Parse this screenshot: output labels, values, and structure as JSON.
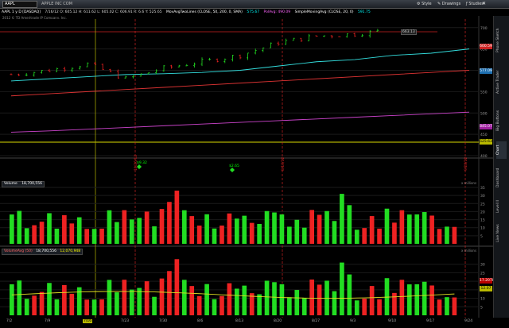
{
  "toolbar": {
    "symbol": "AAPL",
    "company": "APPLE INC COM",
    "buttons": [
      {
        "label": "Style"
      },
      {
        "label": "Drawings"
      },
      {
        "label": "Studies"
      }
    ]
  },
  "studybar": {
    "chart_id": "AAPL 1 y D [DASDAQ]",
    "ohlc": "7/16/12 O: 605.12 H: 611.62 L: 605.02 C: 606.91 R: 6.6 Y: 525.65",
    "studies": [
      {
        "text": "MovAvgTwoLines (CLOSE, 50, 200, 0, SMA)",
        "color": "#ffffff"
      },
      {
        "text": "575.67",
        "color": "#00ffff"
      },
      {
        "text": "PolAvg: 490.09",
        "color": "#ff66ff"
      },
      {
        "text": "SimpleMovingAvg (CLOSE, 20, 0)",
        "color": "#ffffff"
      },
      {
        "text": "591.75",
        "color": "#00ffff"
      }
    ],
    "copyright": "2012 © TD Ameritrade IP Company, Inc."
  },
  "price_panel": {
    "y_ticks": [
      "700",
      "650",
      "600",
      "550",
      "500",
      "450",
      "400",
      "350"
    ],
    "price_boxes": [
      {
        "label": "600.59",
        "color": "#cc2222"
      },
      {
        "label": "577.09",
        "color": "#1e6fb0"
      },
      {
        "label": "845.07",
        "color": "#a020a0"
      },
      {
        "label": "525.63",
        "color": "#b8b800"
      }
    ],
    "high_label": "663.13",
    "events": [
      {
        "label": "$9.32"
      },
      {
        "label": "$2.65"
      }
    ],
    "vertical_labels": [
      "10/26/12",
      "8/10/12",
      "9/28/12"
    ]
  },
  "volume_panel": {
    "title": "Volume",
    "value": "18,700,556",
    "y_ticks": [
      "35",
      "30",
      "25",
      "20",
      "15",
      "10",
      "5"
    ],
    "units": "x millions"
  },
  "volavg_panel": {
    "title": "VolumeAvg (50)",
    "value1": "18,700,556",
    "value2": "12,070,948",
    "y_ticks": [
      "30",
      "25",
      "20",
      "15",
      "10",
      "5"
    ],
    "boxes": [
      {
        "label": "17.2078",
        "color": "#b80000"
      },
      {
        "label": "12.07",
        "color": "#b8b800"
      }
    ],
    "units": "x millions"
  },
  "x_axis": {
    "labels": [
      "7/2",
      "7/9",
      "7/16",
      "7/23",
      "7/30",
      "8/6",
      "8/13",
      "8/20",
      "8/27",
      "9/3",
      "9/10",
      "9/17",
      "9/24"
    ],
    "highlight": "7/16"
  },
  "sidebar": {
    "tabs": [
      "Phone Sketch",
      "Active Trader",
      "Big Buttons",
      "Chart",
      "Dashboard",
      "Level II",
      "Live News"
    ]
  },
  "chart_data": {
    "type": "candlestick",
    "categories": [
      "7/2",
      "7/9",
      "7/16",
      "7/23",
      "7/30",
      "8/6",
      "8/13",
      "8/20",
      "8/27",
      "9/3",
      "9/10",
      "9/17",
      "9/24"
    ],
    "series": [
      {
        "values": [
          590,
          600,
          615,
          580,
          605,
          620,
          635,
          665,
          680,
          685,
          695,
          690,
          670
        ]
      },
      {
        "values": [
          575,
          580,
          585,
          590,
          592,
          595,
          600,
          610,
          620,
          625,
          635,
          640,
          650
        ]
      },
      {
        "values": [
          540,
          545,
          550,
          555,
          560,
          565,
          570,
          575,
          580,
          585,
          590,
          595,
          600
        ]
      },
      {
        "values": [
          455,
          458,
          462,
          466,
          470,
          474,
          478,
          482,
          486,
          490,
          494,
          498,
          502
        ]
      }
    ],
    "ylim": [
      400,
      720
    ]
  }
}
